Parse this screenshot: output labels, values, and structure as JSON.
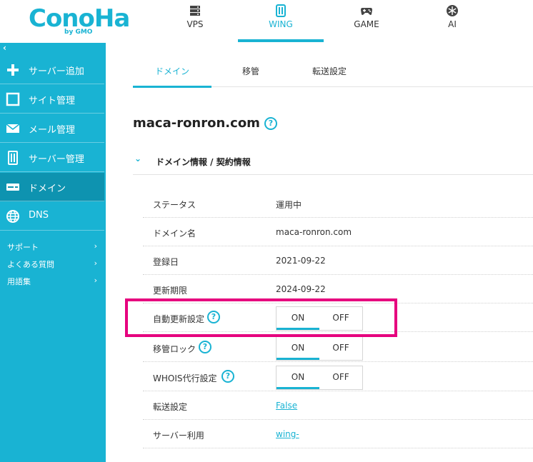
{
  "brand": {
    "logo": "ConoHa",
    "logo_sub": "by GMO",
    "accent": "#19b3d3",
    "highlight": "#e6007e"
  },
  "top_nav": [
    {
      "label": "VPS",
      "icon": "server-icon"
    },
    {
      "label": "WING",
      "icon": "wing-icon",
      "active": true
    },
    {
      "label": "GAME",
      "icon": "gamepad-icon"
    },
    {
      "label": "AI",
      "icon": "ai-icon"
    }
  ],
  "sidebar": {
    "collapse": "‹",
    "items": [
      {
        "label": "サーバー追加",
        "icon": "plus-icon"
      },
      {
        "label": "サイト管理",
        "icon": "site-icon"
      },
      {
        "label": "メール管理",
        "icon": "mail-icon"
      },
      {
        "label": "サーバー管理",
        "icon": "server-manage-icon"
      },
      {
        "label": "ドメイン",
        "icon": "domain-icon",
        "active": true
      },
      {
        "label": "DNS",
        "icon": "globe-icon"
      }
    ],
    "links": [
      {
        "label": "サポート",
        "chev": "›"
      },
      {
        "label": "よくある質問",
        "chev": "›"
      },
      {
        "label": "用語集",
        "chev": "›"
      }
    ]
  },
  "tabs": [
    {
      "label": "ドメイン",
      "active": true
    },
    {
      "label": "移管"
    },
    {
      "label": "転送設定"
    }
  ],
  "domain": {
    "name": "maca-ronron.com",
    "help": "?"
  },
  "section": {
    "title": "ドメイン情報 / 契約情報",
    "chev": "⌄"
  },
  "rows": {
    "status": {
      "label": "ステータス",
      "value": "運用中"
    },
    "domain_name": {
      "label": "ドメイン名",
      "value": "maca-ronron.com"
    },
    "registered": {
      "label": "登録日",
      "value": "2021-09-22"
    },
    "renewal": {
      "label": "更新期限",
      "value": "2024-09-22"
    },
    "auto_renew": {
      "label": "自動更新設定",
      "help": "?",
      "on": "ON",
      "off": "OFF"
    },
    "transfer_lock": {
      "label": "移管ロック",
      "help": "?",
      "on": "ON",
      "off": "OFF"
    },
    "whois": {
      "label": "WHOIS代行設定",
      "help": "?",
      "on": "ON",
      "off": "OFF"
    },
    "forwarding": {
      "label": "転送設定",
      "value": "False"
    },
    "server_use": {
      "label": "サーバー利用",
      "value": "wing-"
    }
  }
}
